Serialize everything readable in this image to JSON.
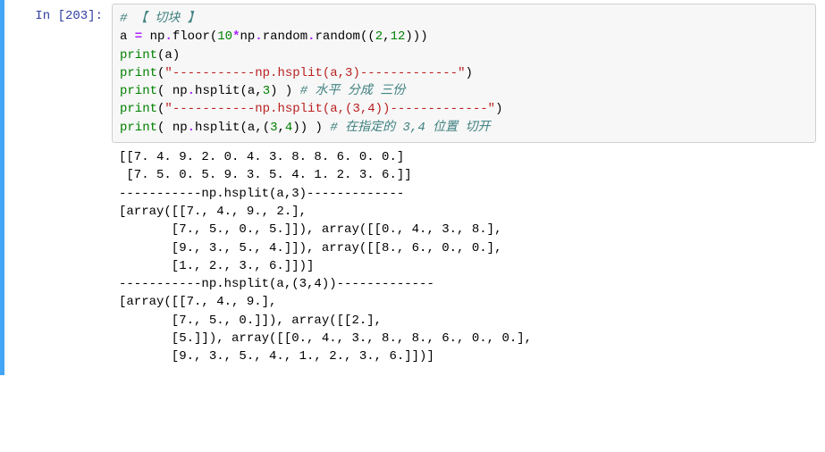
{
  "prompt": {
    "label": "In  [203]:"
  },
  "code": {
    "line1": {
      "comment": "# 【 切块 】"
    },
    "line2": {
      "var": "a",
      "assign": " = ",
      "np": "np",
      "dot1": ".",
      "floor": "floor",
      "open1": "(",
      "ten": "10",
      "mul": "*",
      "np2": "np",
      "dot2": ".",
      "random": "random",
      "dot3": ".",
      "randomfn": "random",
      "open2": "((",
      "two": "2",
      "comma": ",",
      "twelve": "12",
      "close": ")))"
    },
    "line3": {
      "print": "print",
      "open": "(",
      "arg": "a",
      "close": ")"
    },
    "line4": {
      "print": "print",
      "open": "(",
      "str": "\"-----------np.hsplit(a,3)-------------\"",
      "close": ")"
    },
    "line5": {
      "print": "print",
      "open": "( ",
      "np": "np",
      "dot": ".",
      "fn": "hsplit",
      "open2": "(",
      "a": "a",
      "comma": ",",
      "three": "3",
      "close2": ") ",
      "close": ") ",
      "comment": "# 水平 分成 三份"
    },
    "line6": {
      "print": "print",
      "open": "(",
      "str": "\"-----------np.hsplit(a,(3,4))-------------\"",
      "close": ")"
    },
    "line7": {
      "print": "print",
      "open": "( ",
      "np": "np",
      "dot": ".",
      "fn": "hsplit",
      "open2": "(",
      "a": "a",
      "comma": ",",
      "open3": "(",
      "three": "3",
      "comma2": ",",
      "four": "4",
      "close3": ")",
      "close2": ") ",
      "close": ") ",
      "comment": "# 在指定的 3,4 位置 切开"
    }
  },
  "output": {
    "l1": "[[7. 4. 9. 2. 0. 4. 3. 8. 8. 6. 0. 0.]",
    "l2": " [7. 5. 0. 5. 9. 3. 5. 4. 1. 2. 3. 6.]]",
    "l3": "-----------np.hsplit(a,3)-------------",
    "l4": "[array([[7., 4., 9., 2.],",
    "l5": "       [7., 5., 0., 5.]]), array([[0., 4., 3., 8.],",
    "l6": "       [9., 3., 5., 4.]]), array([[8., 6., 0., 0.],",
    "l7": "       [1., 2., 3., 6.]])]",
    "l8": "-----------np.hsplit(a,(3,4))-------------",
    "l9": "[array([[7., 4., 9.],",
    "l10": "       [7., 5., 0.]]), array([[2.],",
    "l11": "       [5.]]), array([[0., 4., 3., 8., 8., 6., 0., 0.],",
    "l12": "       [9., 3., 5., 4., 1., 2., 3., 6.]])]"
  }
}
